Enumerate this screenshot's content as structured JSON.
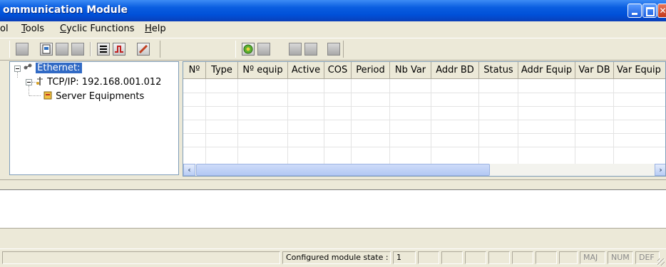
{
  "window": {
    "title": "ommunication Module",
    "buttons": [
      "minimize",
      "maximize",
      "close"
    ]
  },
  "menu": {
    "items": [
      {
        "label": "ol"
      },
      {
        "label": "Tools",
        "mnemonic": "T"
      },
      {
        "label": "Cyclic Functions",
        "mnemonic": "C"
      },
      {
        "label": "Help",
        "mnemonic": "H"
      }
    ]
  },
  "toolbar": {
    "buttons": [
      "save-icon",
      "print-icon",
      "arrow-right-icon",
      "grid-icon",
      "list-icon",
      "signal-icon",
      "pencil-icon",
      "refresh-icon",
      "stop-icon",
      "copy-icon",
      "paste-icon",
      "gear-icon"
    ]
  },
  "tree": {
    "nodes": [
      {
        "label": "Ethernet:",
        "icon": "network-icon",
        "selected": true,
        "level": 0
      },
      {
        "label": "TCP/IP: 192.168.001.012",
        "icon": "tcp-ip-icon",
        "level": 1
      },
      {
        "label": "Server Equipments",
        "icon": "server-icon",
        "level": 2
      }
    ]
  },
  "grid": {
    "columns": [
      "Nº",
      "Type",
      "Nº equip",
      "Active",
      "COS",
      "Period",
      "Nb Var",
      "Addr BD",
      "Status",
      "Addr Equip",
      "Var DB",
      "Var Equip"
    ],
    "rows": []
  },
  "status": {
    "module_state_label": "Configured module state :",
    "module_state_value": "1",
    "indicators": [
      "MAJ",
      "NUM",
      "DEF"
    ]
  },
  "colors": {
    "titlebar": "#0a5ee0",
    "selection": "#316ac5",
    "face": "#ece9d8"
  }
}
